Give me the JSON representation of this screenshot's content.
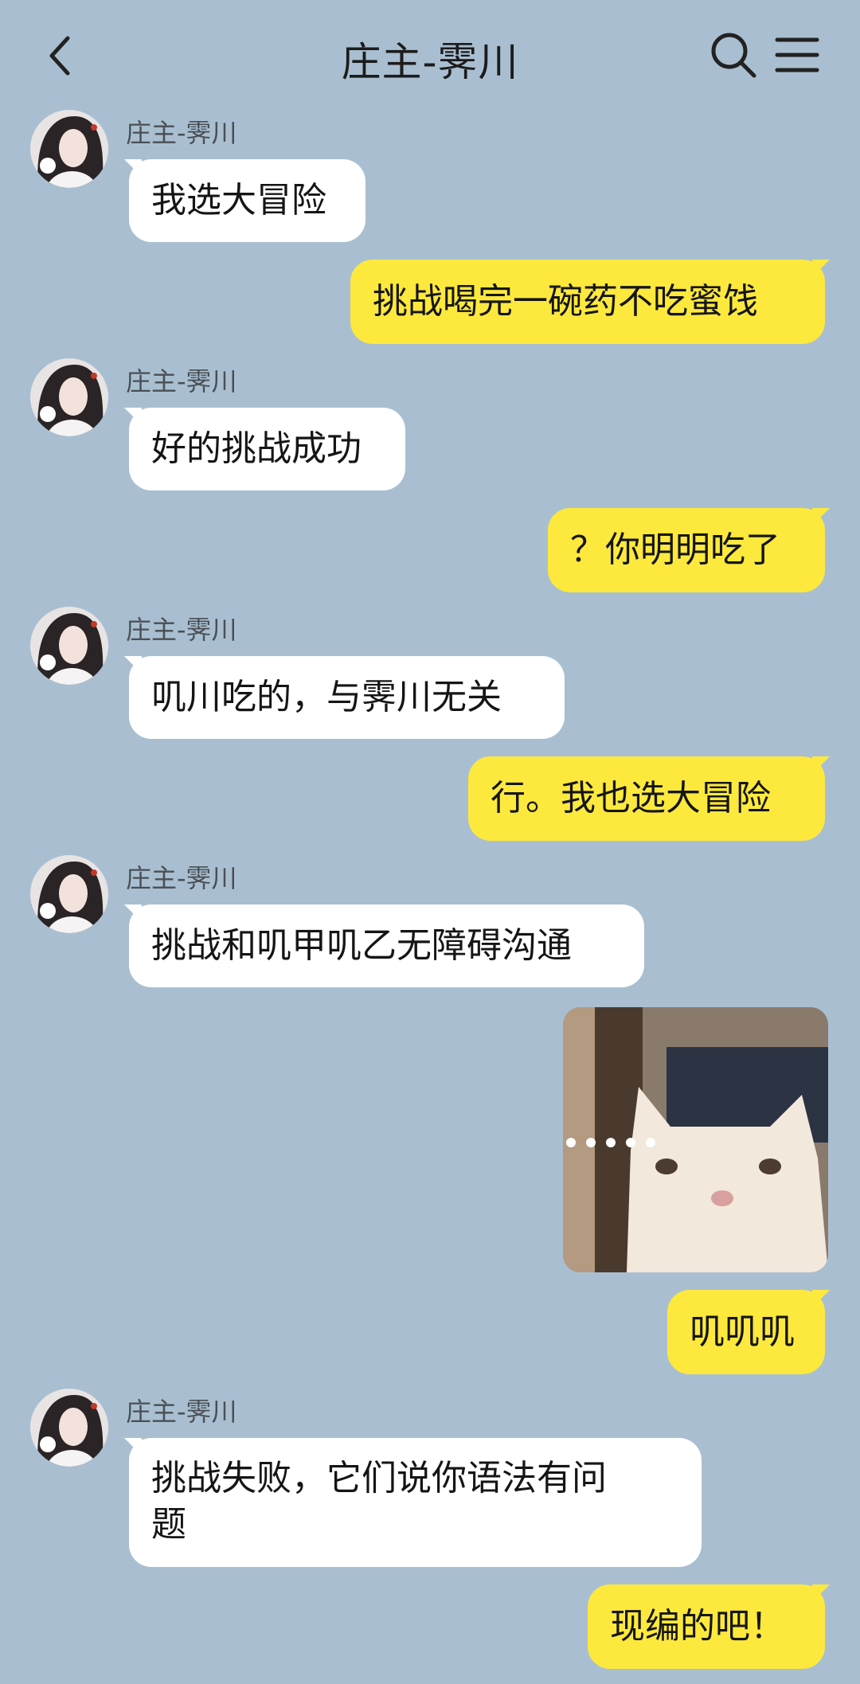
{
  "header": {
    "title": "庄主-霁川",
    "back_icon": "chevron-left-icon",
    "search_icon": "search-icon",
    "menu_icon": "menu-icon"
  },
  "colors": {
    "background": "#a9bfd1",
    "incoming_bubble": "#ffffff",
    "outgoing_bubble": "#fde93d"
  },
  "messages": [
    {
      "side": "incoming",
      "sender": "庄主-霁川",
      "text": "我选大冒险"
    },
    {
      "side": "outgoing",
      "text": "挑战喝完一碗药不吃蜜饯"
    },
    {
      "side": "incoming",
      "sender": "庄主-霁川",
      "text": "好的挑战成功"
    },
    {
      "side": "outgoing",
      "text": "？你明明吃了"
    },
    {
      "side": "incoming",
      "sender": "庄主-霁川",
      "text": "叽川吃的，与霁川无关"
    },
    {
      "side": "outgoing",
      "text": "行。我也选大冒险"
    },
    {
      "side": "incoming",
      "sender": "庄主-霁川",
      "text": "挑战和叽甲叽乙无障碍沟通"
    },
    {
      "side": "outgoing",
      "type": "sticker",
      "text": "cat-sticker-image"
    },
    {
      "side": "outgoing",
      "text": "叽叽叽"
    },
    {
      "side": "incoming",
      "sender": "庄主-霁川",
      "text": "挑战失败，它们说你语法有问\n题"
    },
    {
      "side": "outgoing",
      "text": "现编的吧！"
    }
  ]
}
